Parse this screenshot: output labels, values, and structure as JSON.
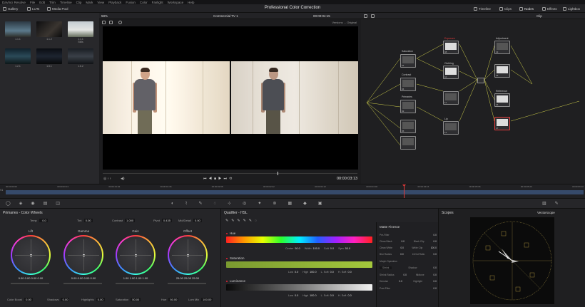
{
  "app": {
    "menu": [
      "DaVinci Resolve",
      "File",
      "Edit",
      "Trim",
      "Timeline",
      "Clip",
      "Mark",
      "View",
      "Playback",
      "Fusion",
      "Color",
      "Fairlight",
      "Workspace",
      "Help"
    ],
    "project_title": "Professional Color Correction",
    "left_tools": {
      "gallery": "Gallery",
      "luts": "LUTs",
      "media_pool": "Media Pool"
    },
    "right_tools": {
      "timeline": "Timeline",
      "clips": "Clips",
      "nodes": "Nodes",
      "effects": "Effects",
      "lightbox": "Lightbox"
    }
  },
  "gallery": {
    "stills": [
      {
        "label": "1.1.1"
      },
      {
        "label": "1.1.2"
      },
      {
        "label": "1.1.1\nStills"
      },
      {
        "label": "1.2.1"
      },
      {
        "label": "1.5.1"
      },
      {
        "label": "1.6.2"
      }
    ]
  },
  "viewer": {
    "zoom": "58%",
    "clip_name": "Commercial TV 1",
    "timecode_top": "00:00:04:15",
    "version": "Versions ... Original",
    "timecode": "00:00:03:13"
  },
  "nodes_panel": {
    "mode": "Clip",
    "nodes": [
      {
        "label": "Saturation",
        "num": "01"
      },
      {
        "label": "Contrast",
        "num": "04"
      },
      {
        "label": "Primaries",
        "num": "02"
      },
      {
        "label": "",
        "num": "05"
      },
      {
        "label": "Exposure",
        "num": "08"
      },
      {
        "label": "Clothing",
        "num": "10"
      },
      {
        "label": "",
        "num": "11"
      },
      {
        "label": "Lip",
        "num": "12"
      },
      {
        "label": "Adjustment",
        "num": "13"
      },
      {
        "label": "",
        "num": "15"
      },
      {
        "label": "Reference",
        "num": "16"
      },
      {
        "label": "",
        "num": "17"
      }
    ]
  },
  "timeline": {
    "ticks": [
      "00:00:00:00",
      "00:00:00:13",
      "00:00:01:04",
      "00:00:01:18",
      "00:00:02:08",
      "00:00:02:22",
      "00:00:03:12",
      "00:00:04:02",
      "00:00:04:16",
      "00:00:05:06",
      "00:00:05:20",
      "00:00:06:10"
    ],
    "track": "V1"
  },
  "primaries": {
    "title": "Primaries - Color Wheels",
    "temp": {
      "label": "Temp",
      "value": "0.0"
    },
    "tint": {
      "label": "Tint",
      "value": "0.00"
    },
    "contrast": {
      "label": "Contrast",
      "value": "1.000"
    },
    "pivot": {
      "label": "Pivot",
      "value": "0.435"
    },
    "md": {
      "label": "Mid/Detail",
      "value": "0.00"
    },
    "wheels": [
      {
        "name": "Lift",
        "vals": [
          "0.00",
          "0.00",
          "0.00",
          "0.00"
        ]
      },
      {
        "name": "Gamma",
        "vals": [
          "0.00",
          "0.00",
          "0.00",
          "0.00"
        ]
      },
      {
        "name": "Gain",
        "vals": [
          "1.00",
          "1.00",
          "1.00",
          "1.00"
        ]
      },
      {
        "name": "Offset",
        "vals": [
          "25.00",
          "25.00",
          "25.00"
        ]
      }
    ],
    "channel_labels": [
      "Y",
      "R",
      "G",
      "B"
    ],
    "bottom": [
      {
        "label": "Color Boost",
        "value": "0.00"
      },
      {
        "label": "Shadows",
        "value": "0.00"
      },
      {
        "label": "Highlights",
        "value": "0.00"
      },
      {
        "label": "Saturation",
        "value": "50.00"
      },
      {
        "label": "Hue",
        "value": "50.00"
      },
      {
        "label": "Lum Mix",
        "value": "100.00"
      }
    ]
  },
  "qualifier": {
    "title": "Qualifier - HSL",
    "hue": {
      "label": "Hue",
      "center": "50.0",
      "width": "100.0",
      "soft": "0.0",
      "sym": "50.0"
    },
    "saturation": {
      "label": "Saturation",
      "low": "0.0",
      "high": "100.0",
      "lsoft": "0.0",
      "hsoft": "0.0"
    },
    "luminance": {
      "label": "Luminance",
      "low": "0.0",
      "high": "100.0",
      "lsoft": "0.0",
      "hsoft": "0.0"
    },
    "field_names": {
      "center": "Center",
      "width": "Width",
      "soft": "Soft",
      "sym": "Sym",
      "low": "Low",
      "high": "High",
      "lsoft": "L. Soft",
      "hsoft": "H. Soft"
    }
  },
  "matte": {
    "title": "Matte Finesse",
    "rows": [
      {
        "label": "Pre-Filter",
        "value": "0.0"
      },
      {
        "label": "Clean Black",
        "value": "0.0",
        "label2": "Black Clip",
        "value2": "0.0"
      },
      {
        "label": "Clean White",
        "value": "0.0",
        "label2": "White Clip",
        "value2": "100.0"
      },
      {
        "label": "Blur Radius",
        "value": "0.0",
        "label2": "In/Out Ratio",
        "value2": "0.0"
      },
      {
        "label": "Morph Operation"
      },
      {
        "label": "Shrink",
        "value2": "0.0",
        "label2": "Shadow"
      },
      {
        "label": "Shrink Radius",
        "value": "0.0",
        "label2": "Midtone",
        "value2": "0.0"
      },
      {
        "label": "Denoise",
        "value": "0.0",
        "label2": "Highlight",
        "value2": "0.0"
      },
      {
        "label": "Post-Filter",
        "value": "0.0"
      }
    ]
  },
  "scopes": {
    "title": "Scopes",
    "type": "Vectorscope"
  },
  "colors": {
    "accent": "#e23b3b",
    "playhead": "#e23b3b",
    "sat_bar": "#a4c83c"
  }
}
